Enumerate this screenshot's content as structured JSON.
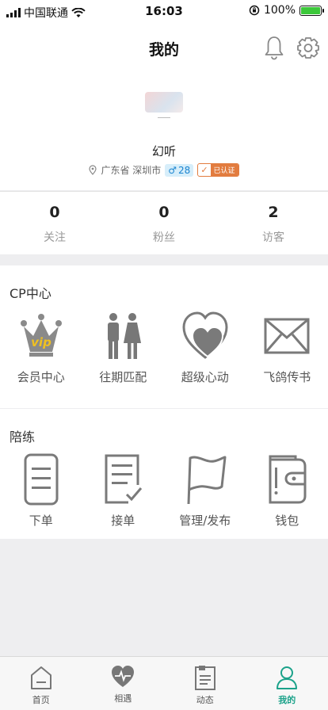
{
  "status_bar": {
    "carrier": "中国联通",
    "time": "16:03",
    "battery": "100%"
  },
  "header": {
    "title": "我的"
  },
  "profile": {
    "name": "幻听",
    "location": "广东省 深圳市",
    "gender_symbol": "♂",
    "age": "28",
    "verified_label": "已认证"
  },
  "stats": [
    {
      "value": "0",
      "label": "关注"
    },
    {
      "value": "0",
      "label": "粉丝"
    },
    {
      "value": "2",
      "label": "访客"
    }
  ],
  "cp_center": {
    "title": "CP中心",
    "items": [
      {
        "label": "会员中心",
        "icon": "vip-crown-icon"
      },
      {
        "label": "往期匹配",
        "icon": "couple-icon"
      },
      {
        "label": "超级心动",
        "icon": "double-heart-icon"
      },
      {
        "label": "飞鸽传书",
        "icon": "envelope-icon"
      }
    ],
    "vip_text": "vip"
  },
  "companion": {
    "title": "陪练",
    "items": [
      {
        "label": "下单",
        "icon": "order-icon"
      },
      {
        "label": "接单",
        "icon": "accept-order-icon"
      },
      {
        "label": "管理/发布",
        "icon": "flag-icon"
      },
      {
        "label": "钱包",
        "icon": "wallet-icon"
      }
    ]
  },
  "tabbar": [
    {
      "label": "首页",
      "icon": "home-icon",
      "active": false
    },
    {
      "label": "相遇",
      "icon": "heartbeat-icon",
      "active": false
    },
    {
      "label": "动态",
      "icon": "feed-icon",
      "active": false
    },
    {
      "label": "我的",
      "icon": "user-icon",
      "active": true
    }
  ],
  "colors": {
    "accent": "#1ba28a",
    "vip_gold": "#f0c020",
    "verified": "#e27c3f",
    "age_blue": "#1a84d0"
  }
}
